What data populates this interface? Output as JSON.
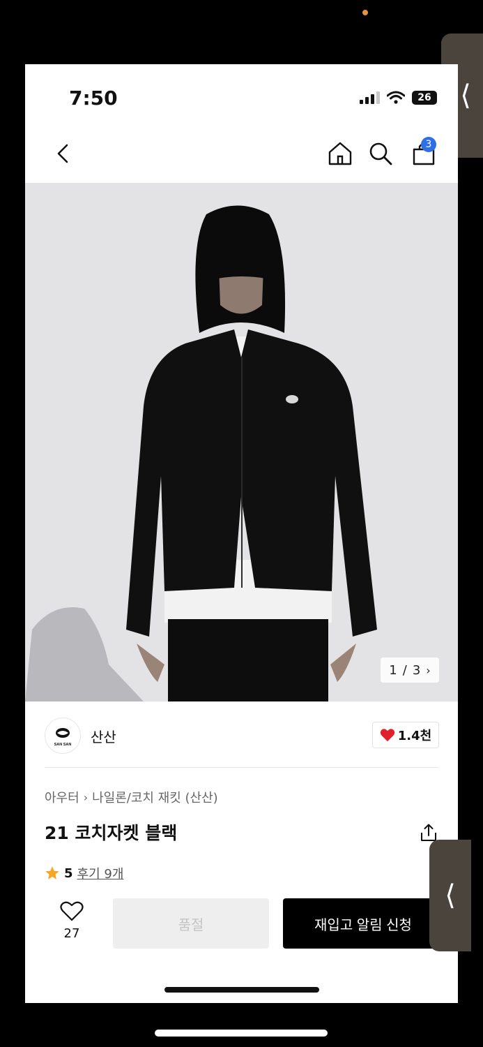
{
  "status_bar": {
    "time": "7:50",
    "battery": "26"
  },
  "nav": {
    "cart_count": "3"
  },
  "gallery": {
    "current": "1",
    "separator": "/",
    "total": "3"
  },
  "brand": {
    "name": "산산",
    "likes": "1.4천",
    "logo_text": "SAN SAN"
  },
  "product": {
    "breadcrumb": [
      "아우터",
      "나일론/코치 재킷 (산산)"
    ],
    "title": "21 코치자켓 블랙",
    "rating": "5",
    "reviews": "후기 9개"
  },
  "actions": {
    "wish_count": "27",
    "soldout_label": "품절",
    "restock_label": "재입고 알림 신청"
  },
  "colors": {
    "accent_blue": "#2f6fe6",
    "heart_red": "#e0202a",
    "star": "#f5a623"
  }
}
